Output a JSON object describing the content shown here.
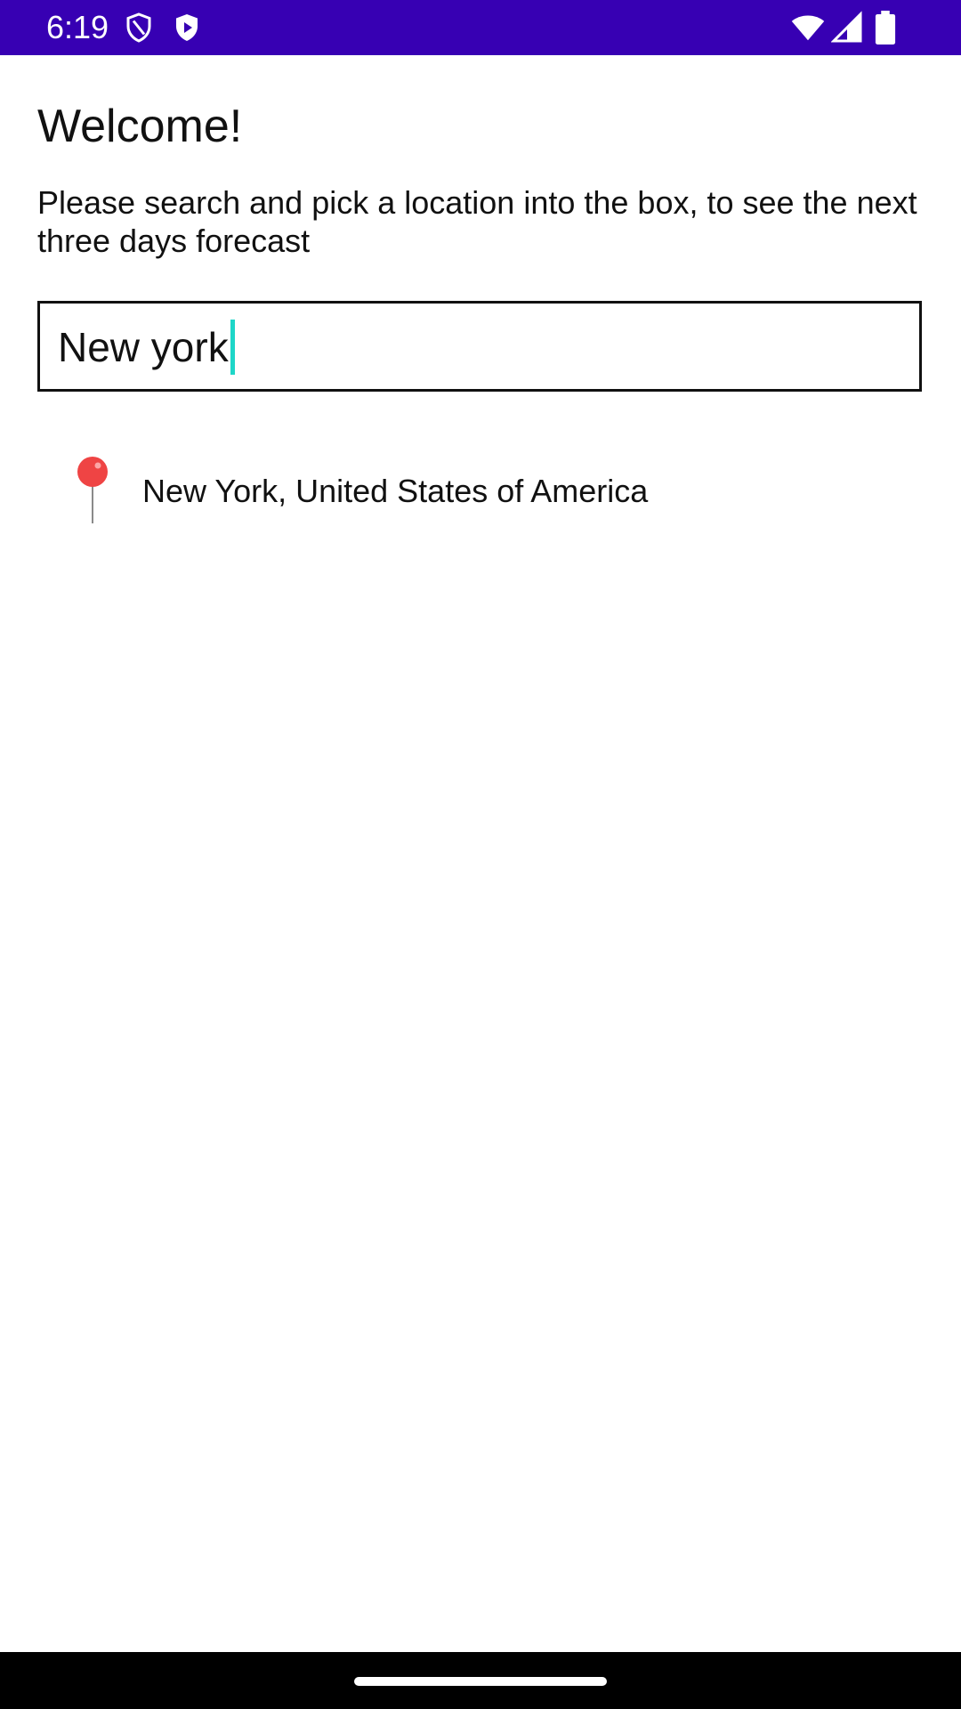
{
  "status_bar": {
    "time": "6:19",
    "icons": [
      "shield-outline-icon",
      "play-shield-icon",
      "wifi-icon",
      "cell-signal-icon",
      "battery-icon"
    ],
    "background_color": "#3700b3"
  },
  "main": {
    "title": "Welcome!",
    "subtitle": "Please search and pick a location into the box, to see the next three days forecast",
    "search": {
      "value": "New york",
      "caret_color": "#1ed6c8"
    },
    "results": [
      {
        "icon": "map-pin-icon",
        "label": "New York, United States of America"
      }
    ]
  }
}
